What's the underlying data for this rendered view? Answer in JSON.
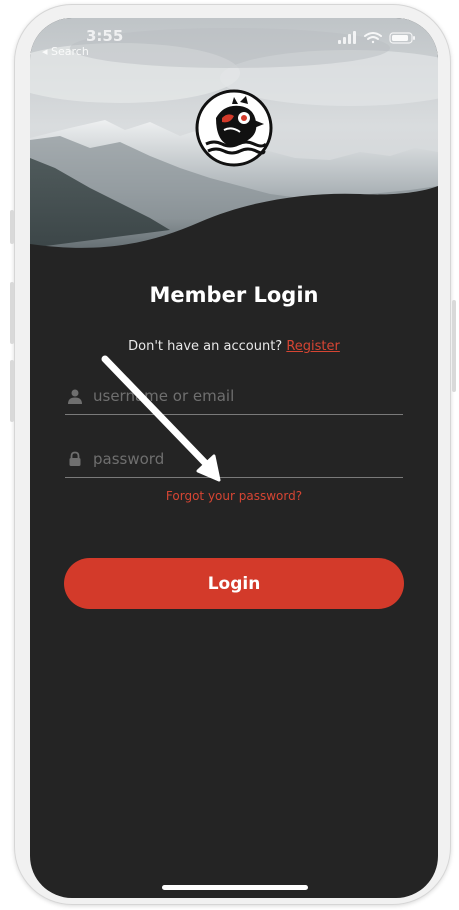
{
  "status_bar": {
    "time": "3:55",
    "back_label": "◂ Search"
  },
  "header": {
    "logo_icon": "native-art-bird-logo-icon",
    "background": "snowy-mountains-photo"
  },
  "login": {
    "title": "Member Login",
    "no_account_text": "Don't have an account?",
    "register_label": "Register",
    "username_placeholder": "username or email",
    "password_placeholder": "password",
    "forgot_label": "Forgot your password?",
    "login_button_label": "Login"
  },
  "colors": {
    "accent": "#d33a2a",
    "background": "#242424"
  }
}
